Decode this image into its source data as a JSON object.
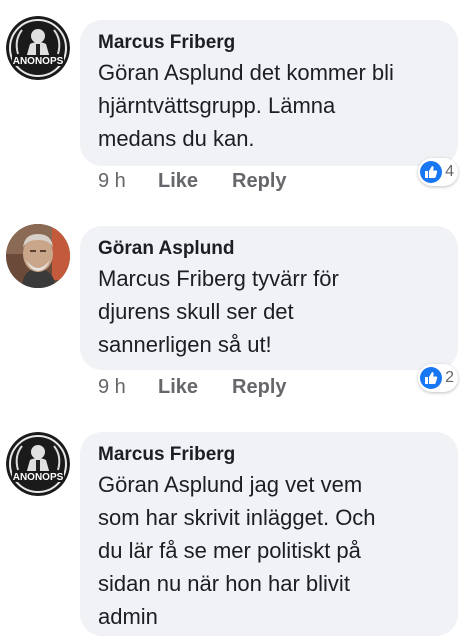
{
  "comments": [
    {
      "author": "Marcus Friberg",
      "avatar_icon": "anonops-logo",
      "avatar_logo_text": "ANONOPS",
      "text": "Göran Asplund det kommer bli\nhjärntvättsgrupp. Lämna\nmedans du kan.",
      "time": "9 h",
      "like_label": "Like",
      "reply_label": "Reply",
      "reaction_count": "4"
    },
    {
      "author": "Göran Asplund",
      "avatar_icon": "user-photo-avatar",
      "text": "Marcus Friberg tyvärr för\ndjurens skull ser det\nsannerligen så ut!",
      "time": "9 h",
      "like_label": "Like",
      "reply_label": "Reply",
      "reaction_count": "2"
    },
    {
      "author": "Marcus Friberg",
      "avatar_icon": "anonops-logo",
      "avatar_logo_text": "ANONOPS",
      "text": "Göran Asplund jag vet vem\nsom har skrivit inlägget. Och\ndu lär få se mer politiskt på\nsidan nu när hon har blivit\nadmin"
    }
  ],
  "colors": {
    "bubble_bg": "#f0f2f5",
    "like_blue": "#1877f2",
    "meta_gray": "#65676b"
  }
}
